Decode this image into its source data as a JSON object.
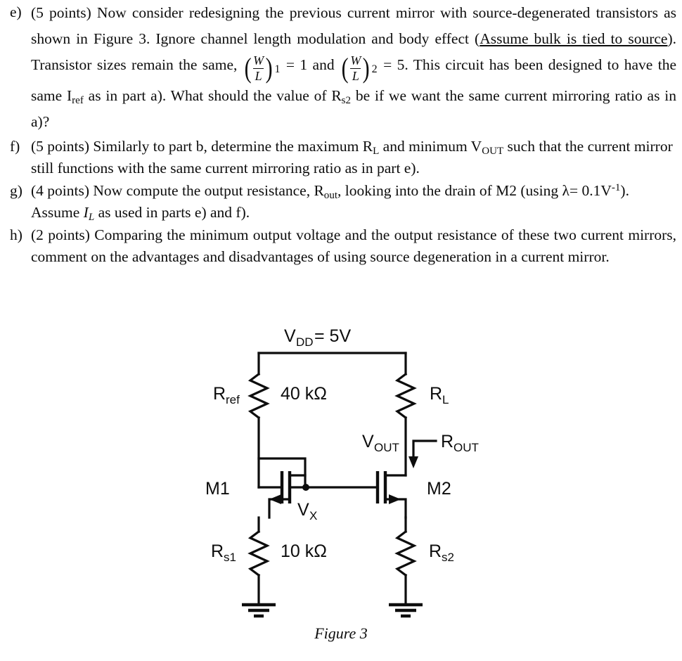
{
  "document": {
    "questions": [
      {
        "marker": "e)",
        "points_label": "(5 points)",
        "text_1": "Now consider redesigning the previous current mirror with source-degenerated transistors as shown in Figure 3. Ignore channel length modulation and body effect (",
        "underlined": "Assume bulk is tied to source",
        "text_2": "). Transistor sizes remain the same, ",
        "frac_1_num": "W",
        "frac_1_den": "L",
        "frac_1_index": "1",
        "text_3": " = 1 and ",
        "frac_2_num": "W",
        "frac_2_den": "L",
        "frac_2_index": "2",
        "text_4": " = 5. This circuit has been designed to have the same I",
        "sub_ref": "ref",
        "text_5": " as in part a). What should the value of R",
        "sub_rs2": "s2",
        "text_6": " be if we want the same current mirroring ratio as in a)?"
      },
      {
        "marker": "f)",
        "points_label": "(5 points)",
        "text_1": "Similarly to part b, determine the maximum R",
        "sub_1": "L",
        "text_2": " and minimum V",
        "sub_2": "OUT",
        "text_3": " such that the current mirror still functions with the same current mirroring ratio as in part e)."
      },
      {
        "marker": "g)",
        "points_label": "(4 points)",
        "text_1": "Now compute the output resistance, R",
        "sub_1": "out",
        "text_2": ", looking into the drain of M2 (using ",
        "lambda": "λ",
        "text_3": "= 0.1V",
        "sup_1": "-1",
        "text_4": "). Assume ",
        "ital_1": "I",
        "ital_sub_1": "L",
        "text_5": " as used in parts e) and f)."
      },
      {
        "marker": "h)",
        "points_label": "(2 points)",
        "text_1": "Comparing the minimum output voltage and the output resistance of these two current mirrors, comment on the advantages and disadvantages of using source degeneration in a current mirror."
      }
    ],
    "figure": {
      "caption": "Figure 3",
      "labels": {
        "vdd": "V",
        "vdd_sub": "DD",
        "vdd_value": " = 5V",
        "rref": "R",
        "rref_sub": "ref",
        "rref_value": "40 kΩ",
        "rl": "R",
        "rl_sub": "L",
        "vout": "V",
        "vout_sub": "OUT",
        "rout": "R",
        "rout_sub": "OUT",
        "m1": "M1",
        "m2": "M2",
        "vx": "V",
        "vx_sub": "X",
        "rs1": "R",
        "rs1_sub": "s1",
        "rs1_value": "10 kΩ",
        "rs2": "R",
        "rs2_sub": "s2"
      },
      "colors": {
        "ink": "#0d0d0d",
        "page": "#ffffff"
      }
    }
  }
}
